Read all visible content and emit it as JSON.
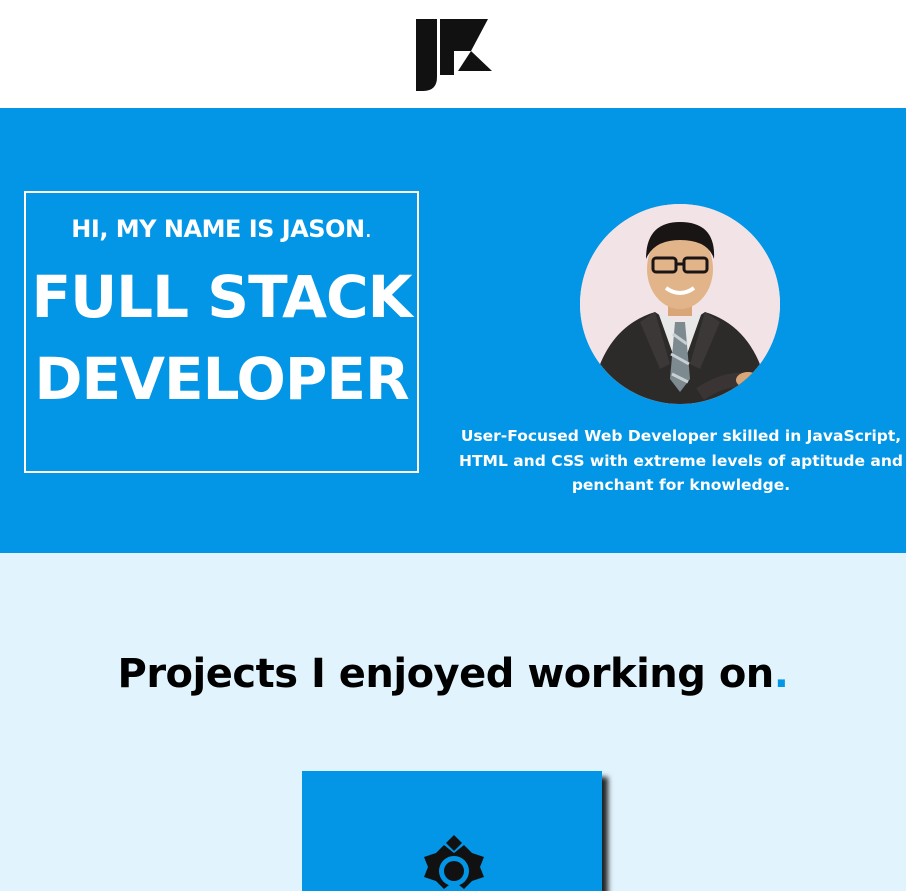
{
  "header": {
    "logo_icon": "jk-monogram-logo-icon"
  },
  "hero": {
    "greeting": "HI, MY NAME IS JASON",
    "greeting_dot": ".",
    "role_line1": "FULL STACK",
    "role_line2": "DEVELOPER",
    "avatar_icon": "profile-photo-avatar",
    "bio": "User-Focused Web Developer skilled in JavaScript, HTML and CSS with extreme levels of aptitude and penchant for knowledge.",
    "background_color": "#0396e6"
  },
  "projects": {
    "title": "Projects I enjoyed working on",
    "title_dot": ".",
    "accent_color": "#0396e6",
    "section_background": "#e1f4fd",
    "card_icon": "temple-project-icon"
  }
}
